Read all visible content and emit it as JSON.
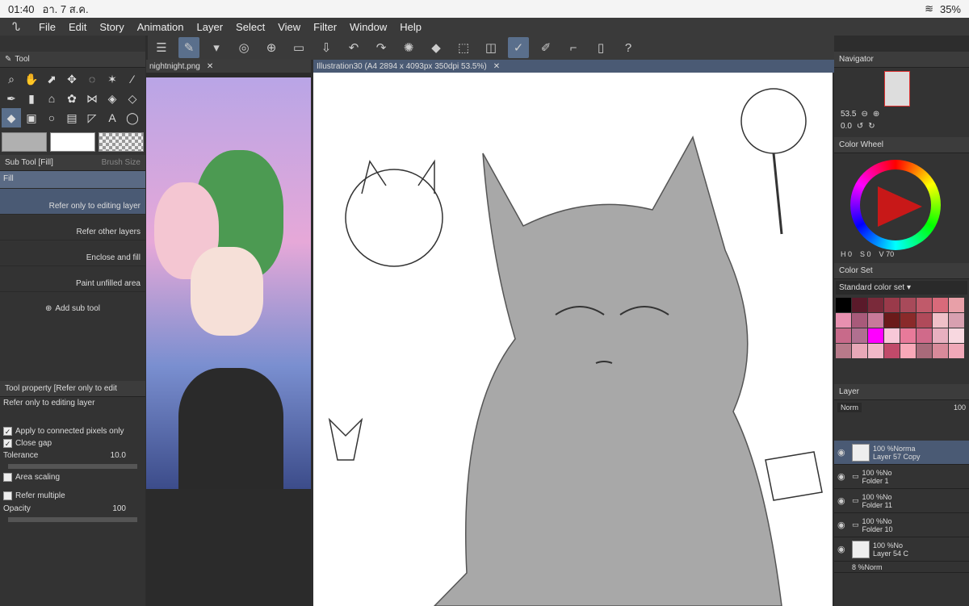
{
  "status": {
    "time": "01:40",
    "date": "อา. 7 ส.ค.",
    "battery": "35%"
  },
  "menu": [
    "File",
    "Edit",
    "Story",
    "Animation",
    "Layer",
    "Select",
    "View",
    "Filter",
    "Window",
    "Help"
  ],
  "tabs": {
    "left": "nightnight.png",
    "main": "Illustration30 (A4 2894 x 4093px 350dpi 53.5%)"
  },
  "tool_panel": {
    "title": "Tool"
  },
  "subtool_panel": {
    "title": "Sub Tool [Fill]",
    "title2": "Brush Size",
    "items": [
      "Fill",
      "Refer only to editing layer",
      "Refer other layers",
      "Enclose and fill",
      "Paint unfilled area"
    ],
    "add": "Add sub tool"
  },
  "tool_property": {
    "title": "Tool property [Refer only to edit",
    "subtitle": "Refer only to editing layer",
    "apply": "Apply to connected pixels only",
    "close_gap": "Close gap",
    "tolerance": "Tolerance",
    "tolerance_value": "10.0",
    "area_scaling": "Area scaling",
    "refer_multiple": "Refer multiple",
    "opacity": "Opacity",
    "opacity_value": "100"
  },
  "navigator": {
    "title": "Navigator",
    "zoom": "53.5",
    "angle": "0.0"
  },
  "color_wheel": {
    "title": "Color Wheel",
    "h": "0",
    "s": "0",
    "v": "70"
  },
  "color_set": {
    "title": "Color Set",
    "select": "Standard color set"
  },
  "layer_panel": {
    "title": "Layer",
    "blend": "Norm",
    "opacity": "100",
    "layers": [
      {
        "pct": "100 %Norma",
        "name": "Layer 57 Copy"
      },
      {
        "pct": "100 %No",
        "name": "Folder 1"
      },
      {
        "pct": "100 %No",
        "name": "Folder 11"
      },
      {
        "pct": "100 %No",
        "name": "Folder 10"
      },
      {
        "pct": "100 %No",
        "name": "Layer 54 C"
      },
      {
        "pct": "8 %Norm",
        "name": ""
      }
    ]
  },
  "colors": {
    "accent": "#5a6f8c"
  }
}
